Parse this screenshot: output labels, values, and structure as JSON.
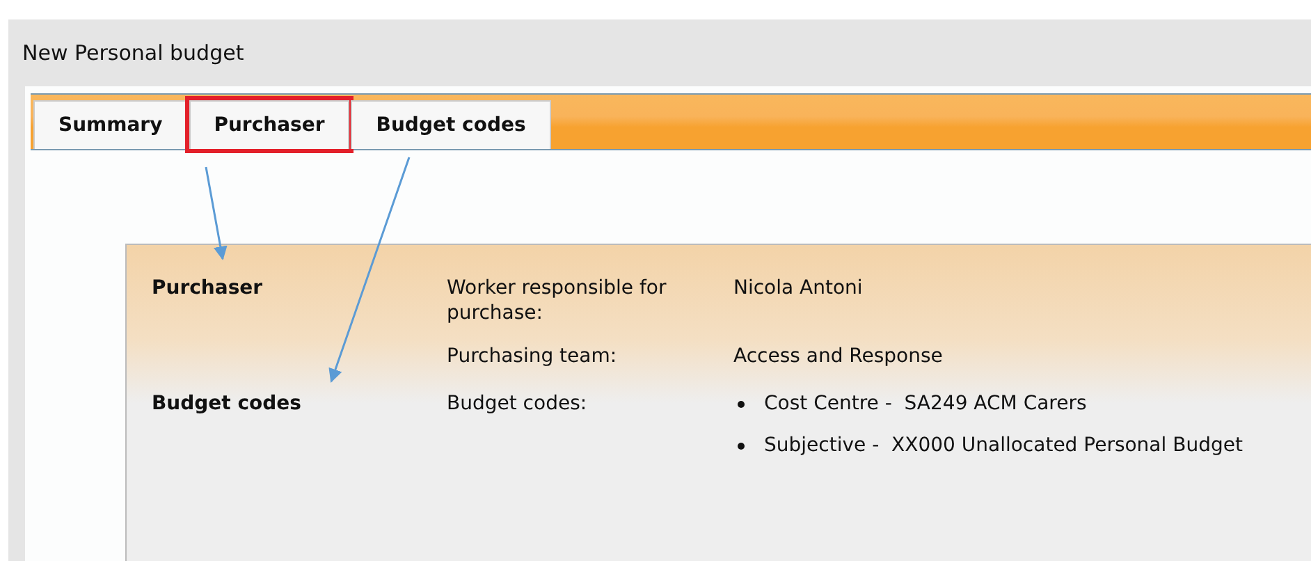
{
  "window": {
    "title": "New Personal budget"
  },
  "tabs": [
    {
      "label": "Summary",
      "annotated": false
    },
    {
      "label": "Purchaser",
      "annotated": true
    },
    {
      "label": "Budget codes",
      "annotated": false
    }
  ],
  "sections": [
    {
      "heading": "Purchaser",
      "fields": [
        {
          "label": "Worker responsible for purchase:",
          "kind": "text",
          "value": "Nicola Antoni"
        },
        {
          "label": "Purchasing team:",
          "kind": "text",
          "value": "Access and Response"
        }
      ]
    },
    {
      "heading": "Budget codes",
      "fields": [
        {
          "label": "Budget codes:",
          "kind": "list",
          "items": [
            "Cost Centre -  SA249 ACM Carers",
            "Subjective -  XX000 Unallocated Personal Budget"
          ]
        }
      ]
    }
  ]
}
